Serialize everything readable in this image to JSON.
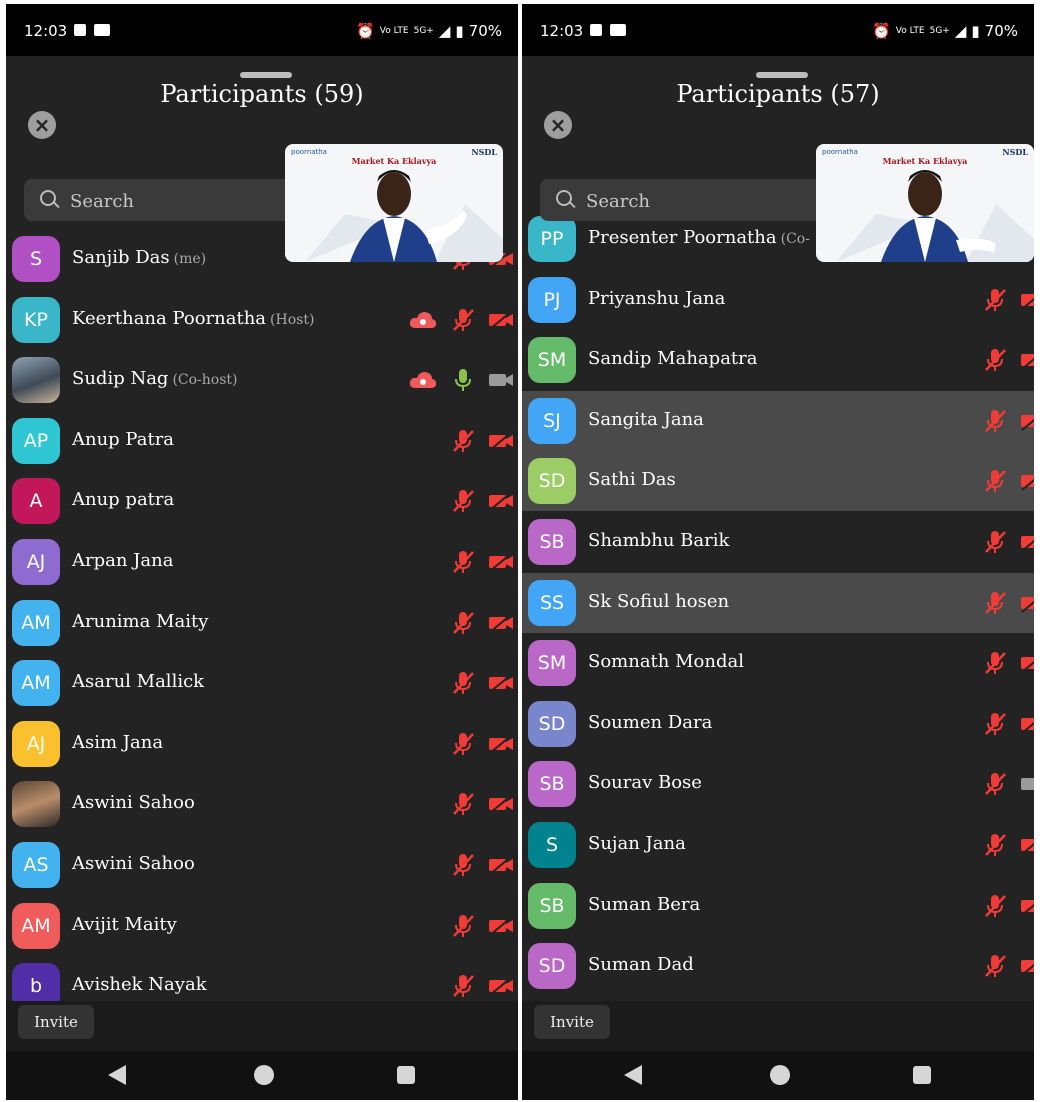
{
  "colors": {
    "panel": "#232323",
    "mute_red": "#f03b37",
    "active_green": "#8bc34a",
    "cloud_red": "#f05a5a"
  },
  "screens": [
    {
      "status": {
        "time": "12:03",
        "network_top": "Vo LTE",
        "network": "5G+",
        "battery": "70%"
      },
      "title": "Participants (59)",
      "search_placeholder": "Search",
      "video": {
        "brand": "poornatha",
        "tagline": "Market Ka Eklavya",
        "partner": "NSDL"
      },
      "invite_label": "Invite",
      "participants": [
        {
          "initials": "S",
          "name": "Sanjib Das",
          "role": "(me)",
          "color": "#b14fc5",
          "mic": "muted",
          "cam": "off"
        },
        {
          "initials": "KP",
          "name": "Keerthana Poornatha",
          "role": "(Host)",
          "color": "#3ab6c9",
          "cloud": true,
          "mic": "muted",
          "cam": "off"
        },
        {
          "initials": "",
          "name": "Sudip Nag",
          "role": "(Co-host)",
          "photo": "photo",
          "cloud": true,
          "mic": "active",
          "cam": "on"
        },
        {
          "initials": "AP",
          "name": "Anup Patra",
          "color": "#2ec7d3",
          "mic": "muted",
          "cam": "off"
        },
        {
          "initials": "A",
          "name": "Anup patra",
          "color": "#c2185b",
          "mic": "muted",
          "cam": "off"
        },
        {
          "initials": "AJ",
          "name": "Arpan Jana",
          "color": "#8e6bd1",
          "mic": "muted",
          "cam": "off"
        },
        {
          "initials": "AM",
          "name": "Arunima Maity",
          "color": "#42b3ee",
          "mic": "muted",
          "cam": "off"
        },
        {
          "initials": "AM",
          "name": "Asarul Mallick",
          "color": "#42b3ee",
          "mic": "muted",
          "cam": "off"
        },
        {
          "initials": "AJ",
          "name": "Asim Jana",
          "color": "#fbc02d",
          "mic": "muted",
          "cam": "off"
        },
        {
          "initials": "",
          "name": "Aswini Sahoo",
          "photo": "photo2",
          "mic": "muted",
          "cam": "off"
        },
        {
          "initials": "AS",
          "name": "Aswini Sahoo",
          "color": "#42b3ee",
          "mic": "muted",
          "cam": "off"
        },
        {
          "initials": "AM",
          "name": "Avijit Maity",
          "color": "#f05c5c",
          "mic": "muted",
          "cam": "off"
        },
        {
          "initials": "b",
          "name": "Avishek Nayak",
          "color": "#512da8",
          "mic": "muted",
          "cam": "off"
        }
      ]
    },
    {
      "status": {
        "time": "12:03",
        "network_top": "Vo LTE",
        "network": "5G+",
        "battery": "70%"
      },
      "title": "Participants (57)",
      "search_placeholder": "Search",
      "video": {
        "brand": "poornatha",
        "tagline": "Market Ka Eklavya",
        "partner": "NSDL"
      },
      "invite_label": "Invite",
      "participants": [
        {
          "initials": "PP",
          "name": "Presenter Poornatha",
          "role": "(Co-",
          "color": "#3ab6c9",
          "mic": "muted",
          "cam": "off"
        },
        {
          "initials": "PJ",
          "name": "Priyanshu Jana",
          "color": "#42a5f5",
          "mic": "muted",
          "cam": "off"
        },
        {
          "initials": "SM",
          "name": "Sandip Mahapatra",
          "color": "#66bb6a",
          "mic": "muted",
          "cam": "off"
        },
        {
          "initials": "SJ",
          "name": "Sangita Jana",
          "color": "#42a5f5",
          "highlight": true,
          "mic": "muted",
          "cam": "off"
        },
        {
          "initials": "SD",
          "name": "Sathi Das",
          "color": "#9ccc65",
          "highlight": true,
          "mic": "muted",
          "cam": "off"
        },
        {
          "initials": "SB",
          "name": "Shambhu Barik",
          "color": "#ba68c8",
          "mic": "muted",
          "cam": "off"
        },
        {
          "initials": "SS",
          "name": "Sk Sofiul hosen",
          "color": "#42a5f5",
          "highlight": true,
          "mic": "muted",
          "cam": "off"
        },
        {
          "initials": "SM",
          "name": "Somnath Mondal",
          "color": "#ba68c8",
          "mic": "muted",
          "cam": "off"
        },
        {
          "initials": "SD",
          "name": "Soumen Dara",
          "color": "#7986cb",
          "mic": "muted",
          "cam": "off"
        },
        {
          "initials": "SB",
          "name": "Sourav Bose",
          "color": "#ba68c8",
          "mic": "muted",
          "cam": "on"
        },
        {
          "initials": "S",
          "name": "Sujan Jana",
          "color": "#00838f",
          "mic": "muted",
          "cam": "off"
        },
        {
          "initials": "SB",
          "name": "Suman Bera",
          "color": "#66bb6a",
          "mic": "muted",
          "cam": "off"
        },
        {
          "initials": "SD",
          "name": "Suman Dad",
          "color": "#ba68c8",
          "mic": "muted",
          "cam": "off"
        }
      ]
    }
  ]
}
